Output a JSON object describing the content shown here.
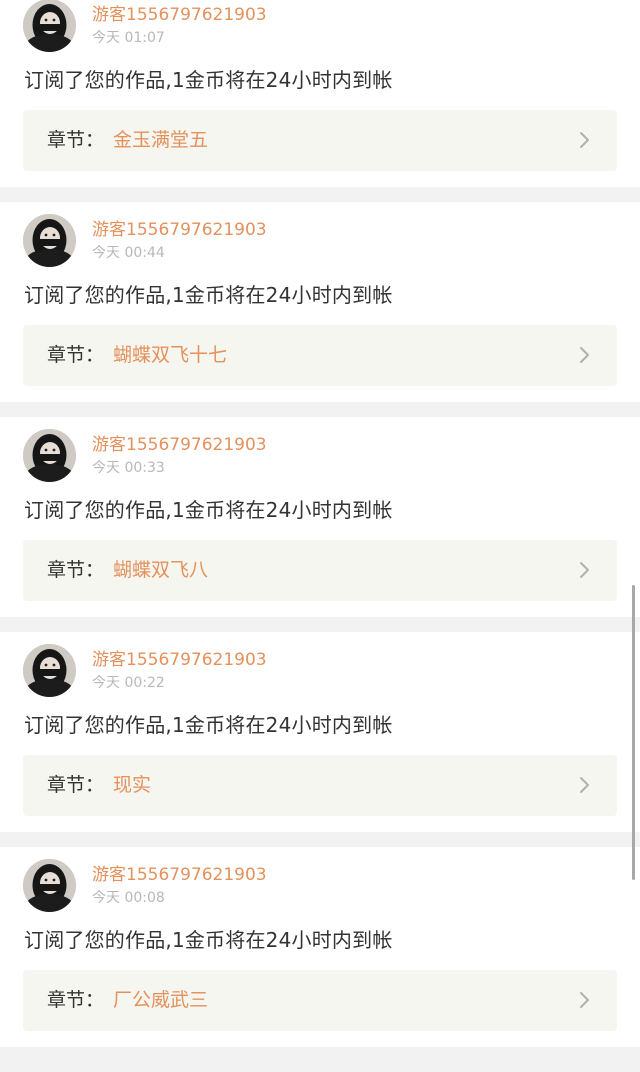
{
  "feed": {
    "items": [
      {
        "username": "游客1556797621903",
        "time": "今天 01:07",
        "message": "订阅了您的作品,1金币将在24小时内到帐",
        "chapter_label": "章节：",
        "chapter_title": "金玉满堂五"
      },
      {
        "username": "游客1556797621903",
        "time": "今天 00:44",
        "message": "订阅了您的作品,1金币将在24小时内到帐",
        "chapter_label": "章节：",
        "chapter_title": "蝴蝶双飞十七"
      },
      {
        "username": "游客1556797621903",
        "time": "今天 00:33",
        "message": "订阅了您的作品,1金币将在24小时内到帐",
        "chapter_label": "章节：",
        "chapter_title": "蝴蝶双飞八"
      },
      {
        "username": "游客1556797621903",
        "time": "今天 00:22",
        "message": "订阅了您的作品,1金币将在24小时内到帐",
        "chapter_label": "章节：",
        "chapter_title": "现实"
      },
      {
        "username": "游客1556797621903",
        "time": "今天 00:08",
        "message": "订阅了您的作品,1金币将在24小时内到帐",
        "chapter_label": "章节：",
        "chapter_title": "厂公威武三"
      }
    ]
  },
  "icons": {
    "avatar": "avatar-photo",
    "chevron": "chevron-right-icon"
  },
  "colors": {
    "accent": "#e4915c",
    "text": "#333333",
    "muted": "#b8b8b8",
    "chapter_bg": "#f6f6f1",
    "page_bg": "#f2f2f2"
  }
}
